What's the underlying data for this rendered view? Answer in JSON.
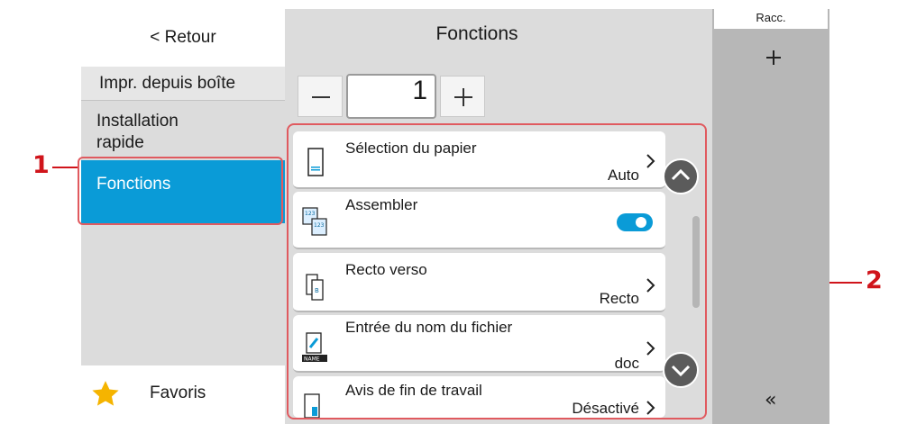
{
  "callouts": {
    "left": "1",
    "right": "2"
  },
  "sidebar": {
    "back_label": "< Retour",
    "items": [
      {
        "label": "Impr. depuis boîte"
      },
      {
        "label": "Installation rapide"
      },
      {
        "label": "Fonctions"
      }
    ],
    "favorites_label": "Favoris"
  },
  "main": {
    "title": "Fonctions",
    "copies": {
      "value": "1",
      "minus_label": "−",
      "plus_label": "+"
    },
    "functions": [
      {
        "label": "Sélection du papier",
        "value": "Auto",
        "icon": "paper-tray-icon"
      },
      {
        "label": "Assembler",
        "toggle": true,
        "icon": "collate-icon"
      },
      {
        "label": "Recto verso",
        "value": "Recto",
        "icon": "duplex-icon"
      },
      {
        "label": "Entrée du nom du fichier",
        "value": "doc",
        "icon": "file-name-icon"
      },
      {
        "label": "Avis de fin de travail",
        "value": "Désactivé",
        "icon": "job-end-notice-icon"
      }
    ]
  },
  "right_panel": {
    "shortcut_label": "Racc.",
    "collapse_label": "«"
  },
  "colors": {
    "accent": "#0a9bd7",
    "callout": "#d0141b",
    "frame": "#e05a5f"
  }
}
